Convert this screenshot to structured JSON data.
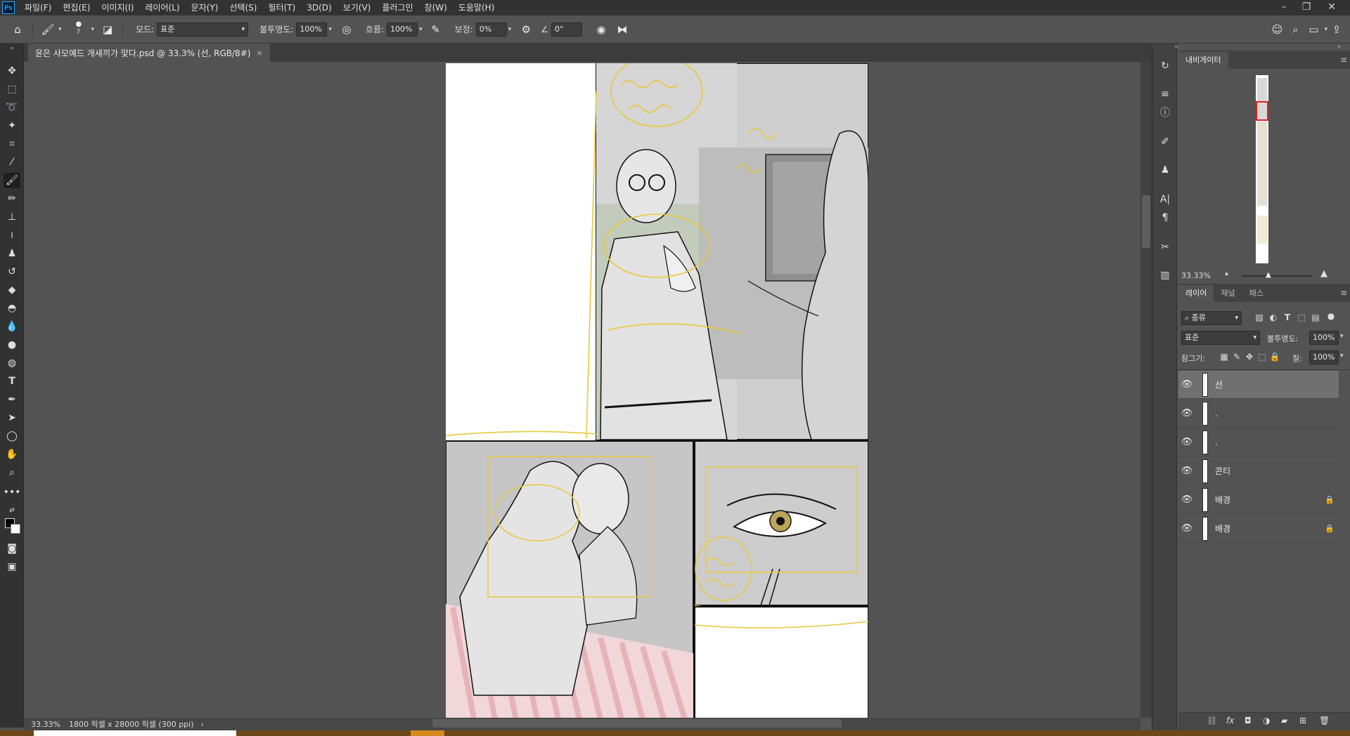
{
  "app": {
    "logo_text": "Ps"
  },
  "menu": [
    "파일(F)",
    "편집(E)",
    "이미지(I)",
    "레이어(L)",
    "문자(Y)",
    "선택(S)",
    "필터(T)",
    "3D(D)",
    "보기(V)",
    "플러그인",
    "창(W)",
    "도움말(H)"
  ],
  "window_controls": {
    "minimize": "–",
    "restore": "❐",
    "close": "✕"
  },
  "options": {
    "brush_size": "7",
    "mode_label": "모드:",
    "mode_value": "표준",
    "opacity_label": "불투명도:",
    "opacity_value": "100%",
    "flow_label": "흐름:",
    "flow_value": "100%",
    "smoothing_label": "보정:",
    "smoothing_value": "0%",
    "angle_value": "0°"
  },
  "document": {
    "tab_title": "윤은 사모예드 개새끼가 맞다.psd @ 33.3% (선, RGB/8#)",
    "close_symbol": "×"
  },
  "status": {
    "zoom": "33.33%",
    "info": "1800 픽셀 x 28000 픽셀 (300 ppi)",
    "arrow": "›"
  },
  "navigator": {
    "tab": "내비게이터",
    "zoom": "33.33%"
  },
  "layers_panel": {
    "tabs": [
      "레이어",
      "채널",
      "패스"
    ],
    "filter_value": "종류",
    "blend_mode": "표준",
    "opacity_label": "불투명도:",
    "opacity_value": "100%",
    "lock_label": "잠그기:",
    "fill_label": "칠:",
    "fill_value": "100%",
    "layers": [
      {
        "name": "선",
        "selected": true,
        "locked": false
      },
      {
        "name": ".",
        "selected": false,
        "locked": false
      },
      {
        "name": ".",
        "selected": false,
        "locked": false
      },
      {
        "name": "콘티",
        "selected": false,
        "locked": false
      },
      {
        "name": "배경",
        "selected": false,
        "locked": true
      },
      {
        "name": "배경",
        "selected": false,
        "locked": true
      }
    ]
  },
  "colors": {
    "sketch_yellow": "#e8c83a",
    "stripe_pink": "#e8b4b8",
    "panel_gray": "#c8c8c8",
    "selection_red": "#e02020"
  }
}
